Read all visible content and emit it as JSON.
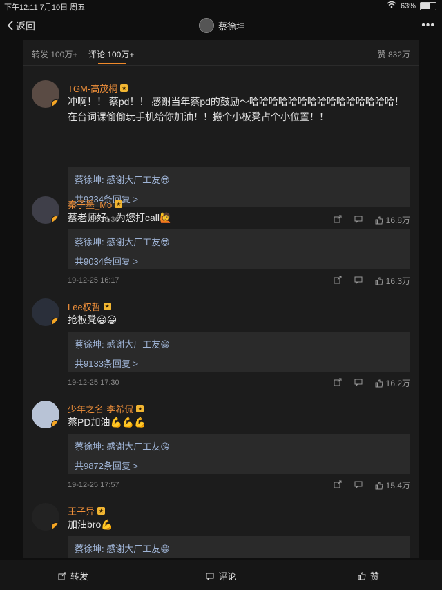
{
  "status": {
    "time": "下午12:11  7月10日 周五",
    "battery": "63%"
  },
  "topbar": {
    "back": "返回",
    "title": "蔡徐坤",
    "more": "•••"
  },
  "tabs": {
    "repost": "转发 100万+",
    "comment": "评论 100万+",
    "likes": "赞 832万"
  },
  "comments": [
    {
      "name": "TGM-高茂桐",
      "text": "冲啊！！ 蔡pd！！ 感谢当年蔡pd的鼓励～哈哈哈哈哈哈哈哈哈哈哈哈哈哈哈！在台词课偷偷玩手机给你加油！！搬个小板凳占个小位置！！",
      "reply_text": "蔡徐坤: 感谢大厂工友😎",
      "reply_count": "共9234条回复 >",
      "time": "19-12-25 16:36",
      "likes": "16.8万"
    },
    {
      "name": "秦子墨_Mo",
      "text": "蔡老师好，为您打call🙋",
      "reply_text": "蔡徐坤: 感谢大厂工友😎",
      "reply_count": "共9034条回复 >",
      "time": "19-12-25 16:17",
      "likes": "16.3万"
    },
    {
      "name": "Lee权哲",
      "text": "抢板凳😀😀",
      "reply_text": "蔡徐坤: 感谢大厂工友😁",
      "reply_count": "共9133条回复 >",
      "time": "19-12-25 17:30",
      "likes": "16.2万"
    },
    {
      "name": "少年之名-李希侃",
      "text": "蔡PD加油💪💪💪",
      "reply_text": "蔡徐坤: 感谢大厂工友😘",
      "reply_count": "共9872条回复 >",
      "time": "19-12-25 17:57",
      "likes": "15.4万"
    },
    {
      "name": "王子异",
      "text": "加油bro💪",
      "reply_text": "蔡徐坤: 感谢大厂工友😁",
      "reply_count": "",
      "time": "",
      "likes": ""
    }
  ],
  "bottom": {
    "repost": "转发",
    "comment": "评论",
    "like": "赞"
  }
}
